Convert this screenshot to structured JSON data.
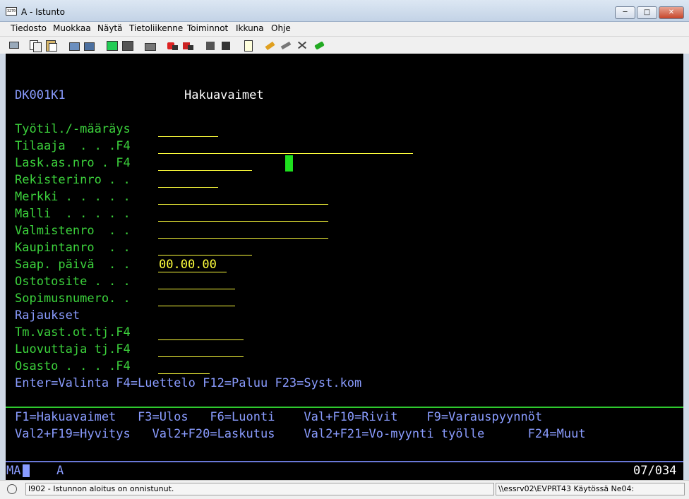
{
  "window": {
    "title": "A - Istunto",
    "icon_label": "3270"
  },
  "window_buttons": {
    "minimize": "─",
    "maximize": "□",
    "close": "✕"
  },
  "menu": [
    "Tiedosto",
    "Muokkaa",
    "Näytä",
    "Tietoliikenne",
    "Toiminnot",
    "Ikkuna",
    "Ohje"
  ],
  "toolbar_icons": [
    "print-screen-icon",
    "copy-icon",
    "paste-icon",
    "send-file-icon",
    "receive-file-icon",
    "display-icon",
    "keypad-icon",
    "macro-icon",
    "record-macro-icon",
    "stop-macro-icon",
    "play-macro-icon",
    "connect-icon",
    "disconnect-icon",
    "clipboard-icon",
    "edit-icon",
    "settings-icon",
    "tools-icon",
    "help-icon"
  ],
  "screen": {
    "program_id": "DK001K1",
    "heading": "Hakuavaimet",
    "fields": [
      {
        "label": "Työtil./-määräys"
      },
      {
        "label": "Tilaaja  . . .F4"
      },
      {
        "label": "Lask.as.nro . F4"
      },
      {
        "label": "Rekisterinro . ."
      },
      {
        "label": "Merkki . . . . ."
      },
      {
        "label": "Malli  . . . . ."
      },
      {
        "label": "Valmistenro  . ."
      },
      {
        "label": "Kaupintanro  . ."
      },
      {
        "label": "Saap. päivä  . .",
        "value": "00.00.00"
      },
      {
        "label": "Ostotosite . . ."
      },
      {
        "label": "Sopimusnumero. ."
      },
      {
        "label": "Rajaukset"
      },
      {
        "label": "Tm.vast.ot.tj.F4"
      },
      {
        "label": "Luovuttaja tj.F4"
      },
      {
        "label": "Osasto . . . .F4"
      }
    ],
    "enter_line": "Enter=Valinta F4=Luettelo F12=Paluu F23=Syst.kom",
    "fkeys_line1": "F1=Hakuavaimet   F3=Ulos   F6=Luonti    Val+F10=Rivit    F9=Varauspyynnöt",
    "fkeys_line2": "Val2+F19=Hyvitys   Val2+F20=Laskutus    Val2+F21=Vo-myynti työlle      F24=Muut"
  },
  "oia": {
    "indicator": "MA",
    "session": "A",
    "cursor_pos": "07/034"
  },
  "status": {
    "message": "I902 - Istunnon aloitus on onnistunut.",
    "connection": "\\\\essrv02\\EVPRT43 Käytössä Ne04:"
  },
  "colors": {
    "screen_bg": "#000000",
    "label": "#3cd23c",
    "blue_text": "#8a9cff",
    "input": "#ffff3c",
    "cursor": "#1ee01e"
  }
}
